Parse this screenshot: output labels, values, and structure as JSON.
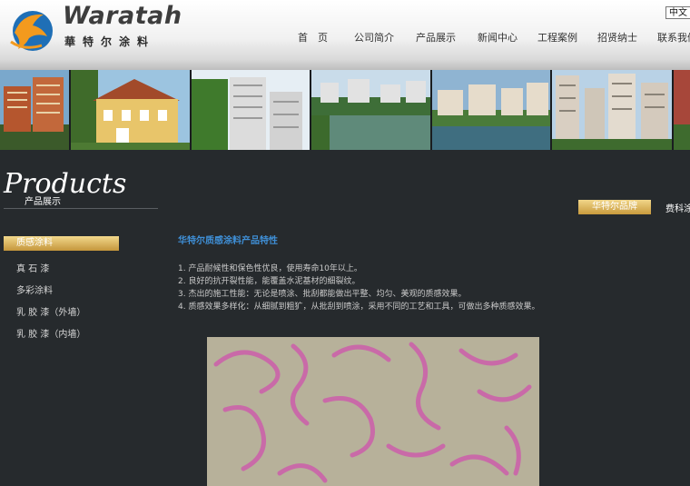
{
  "brand": {
    "name_en": "Waratah",
    "name_cn": "華特尔涂料"
  },
  "language_switch": "中文",
  "nav": [
    "首　页",
    "公司简介",
    "产品展示",
    "新闻中心",
    "工程案例",
    "招贤纳士",
    "联系我们"
  ],
  "section": {
    "title": "Products",
    "subtitle": "产品展示"
  },
  "tabs": {
    "active": "华特尔品牌",
    "next": "费科涂"
  },
  "sidebar": {
    "items": [
      "质感涂料",
      "真 石 漆",
      "多彩涂料",
      "乳 胶 漆（外墙）",
      "乳 胶 漆（内墙）"
    ]
  },
  "content": {
    "title": "华特尔质感涂料产品特性",
    "features": [
      "1. 产品耐候性和保色性优良，使用寿命10年以上。",
      "2. 良好的抗开裂性能，能覆盖水泥基材的细裂纹。",
      "3. 杰出的施工性能：无论是喷涂、批刮都能做出平整、均匀、美观的质感效果。",
      "4. 质感效果多样化：从细腻到粗犷，从批刮到喷涂，采用不同的工艺和工具，可做出多种质感效果。"
    ]
  },
  "colors": {
    "background": "#262a2d",
    "accent_gold": "#d4a94e",
    "title_blue": "#3f8fd6",
    "logo_orange": "#f39a1e",
    "logo_blue": "#1f6fb6"
  },
  "icons": {
    "logo": "kangaroo-logo-icon"
  }
}
